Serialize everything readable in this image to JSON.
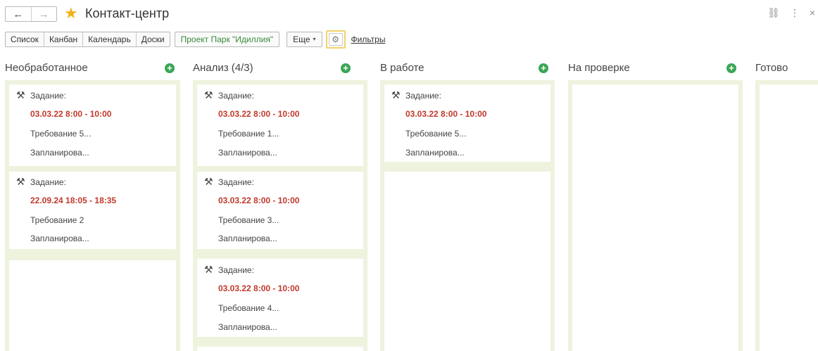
{
  "header": {
    "back_icon": "←",
    "forward_icon": "→",
    "star_icon": "★",
    "title": "Контакт-центр",
    "link_icon": "⛓",
    "more_icon": "⋮",
    "close_icon": "×"
  },
  "toolbar": {
    "tabs": [
      "Список",
      "Канбан",
      "Календарь",
      "Доски"
    ],
    "project": "Проект Парк \"Идиллия\"",
    "more_label": "Еще",
    "more_caret": "▾",
    "gear_icon": "⚙",
    "filters_label": "Фильтры"
  },
  "colors": {
    "lane_bg": "#eef3de",
    "date_red": "#c0392b",
    "plus_green": "#3aa655",
    "star_yellow": "#f2b318"
  },
  "columns": [
    {
      "title": "Необработанное",
      "cards": [
        {
          "kind": "Задание:",
          "time": "03.03.22 8:00 - 10:00",
          "req": "Требование 5...",
          "status": "Запланирова..."
        },
        {
          "kind": "Задание:",
          "time": "22.09.24 18:05 - 18:35",
          "req": "Требование 2",
          "status": "Запланирова..."
        }
      ]
    },
    {
      "title": "Анализ (4/3)",
      "cards": [
        {
          "kind": "Задание:",
          "time": "03.03.22 8:00 - 10:00",
          "req": "Требование 1...",
          "status": "Запланирова..."
        },
        {
          "kind": "Задание:",
          "time": "03.03.22 8:00 - 10:00",
          "req": "Требование 3...",
          "status": "Запланирова..."
        },
        {
          "kind": "Задание:",
          "time": "03.03.22 8:00 - 10:00",
          "req": "Требование 4...",
          "status": "Запланирова..."
        }
      ]
    },
    {
      "title": "В работе",
      "cards": [
        {
          "kind": "Задание:",
          "time": "03.03.22 8:00 - 10:00",
          "req": "Требование 5...",
          "status": "Запланирова..."
        }
      ]
    },
    {
      "title": "На проверке",
      "cards": []
    },
    {
      "title": "Готово",
      "cards": []
    }
  ],
  "plus_icon": "+",
  "tool_icon": "⚒"
}
